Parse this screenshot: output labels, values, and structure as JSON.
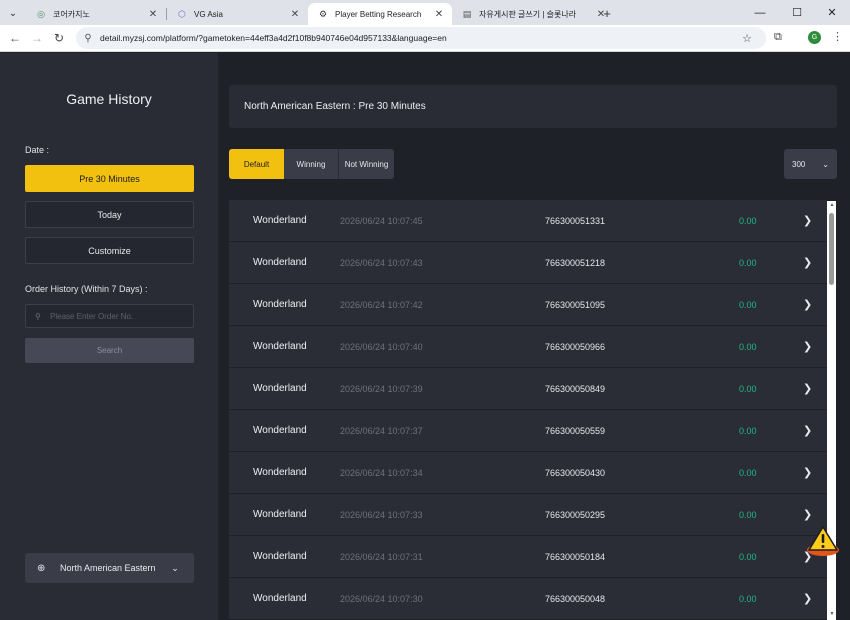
{
  "browser": {
    "tabs": [
      {
        "title": "코어카지노",
        "active": false
      },
      {
        "title": "VG Asia",
        "active": false
      },
      {
        "title": "Player Betting Research",
        "active": true
      },
      {
        "title": "자유게시판 글쓰기 | 슬롯나라",
        "active": false
      }
    ],
    "new_tab": "+",
    "url": "detail.myzsj.com/platform/?gametoken=44eff3a4d2f10f8b940746e04d957133&language=en"
  },
  "sidebar": {
    "title": "Game History",
    "date_label": "Date :",
    "date_options": [
      "Pre 30 Minutes",
      "Today",
      "Customize"
    ],
    "order_label": "Order History (Within 7 Days) :",
    "order_placeholder": "Please Enter Order No.",
    "search_label": "Search",
    "timezone": "North American Eastern"
  },
  "main": {
    "header": "North American Eastern : Pre 30 Minutes",
    "filters": [
      "Default",
      "Winning",
      "Not Winning"
    ],
    "active_filter": "Default",
    "page_size": "300",
    "rows": [
      {
        "game": "Wonderland",
        "time": "2026/06/24 10:07:45",
        "order": "766300051331",
        "amount": "0.00"
      },
      {
        "game": "Wonderland",
        "time": "2026/06/24 10:07:43",
        "order": "766300051218",
        "amount": "0.00"
      },
      {
        "game": "Wonderland",
        "time": "2026/06/24 10:07:42",
        "order": "766300051095",
        "amount": "0.00"
      },
      {
        "game": "Wonderland",
        "time": "2026/06/24 10:07:40",
        "order": "766300050966",
        "amount": "0.00"
      },
      {
        "game": "Wonderland",
        "time": "2026/06/24 10:07:39",
        "order": "766300050849",
        "amount": "0.00"
      },
      {
        "game": "Wonderland",
        "time": "2026/06/24 10:07:37",
        "order": "766300050559",
        "amount": "0.00"
      },
      {
        "game": "Wonderland",
        "time": "2026/06/24 10:07:34",
        "order": "766300050430",
        "amount": "0.00"
      },
      {
        "game": "Wonderland",
        "time": "2026/06/24 10:07:33",
        "order": "766300050295",
        "amount": "0.00"
      },
      {
        "game": "Wonderland",
        "time": "2026/06/24 10:07:31",
        "order": "766300050184",
        "amount": "0.00"
      },
      {
        "game": "Wonderland",
        "time": "2026/06/24 10:07:30",
        "order": "766300050048",
        "amount": "0.00"
      }
    ]
  },
  "colors": {
    "accent": "#f2c00f",
    "win_amount": "#1fb78a",
    "row_bg": "#2b2d36",
    "sidebar_bg": "#2a2c35",
    "page_bg": "#1f2128"
  },
  "icons": {
    "tab_search": "chevron-down-icon",
    "row_action": "chevron-right-icon",
    "timezone": "globe-icon",
    "floating": "warning-icon"
  }
}
